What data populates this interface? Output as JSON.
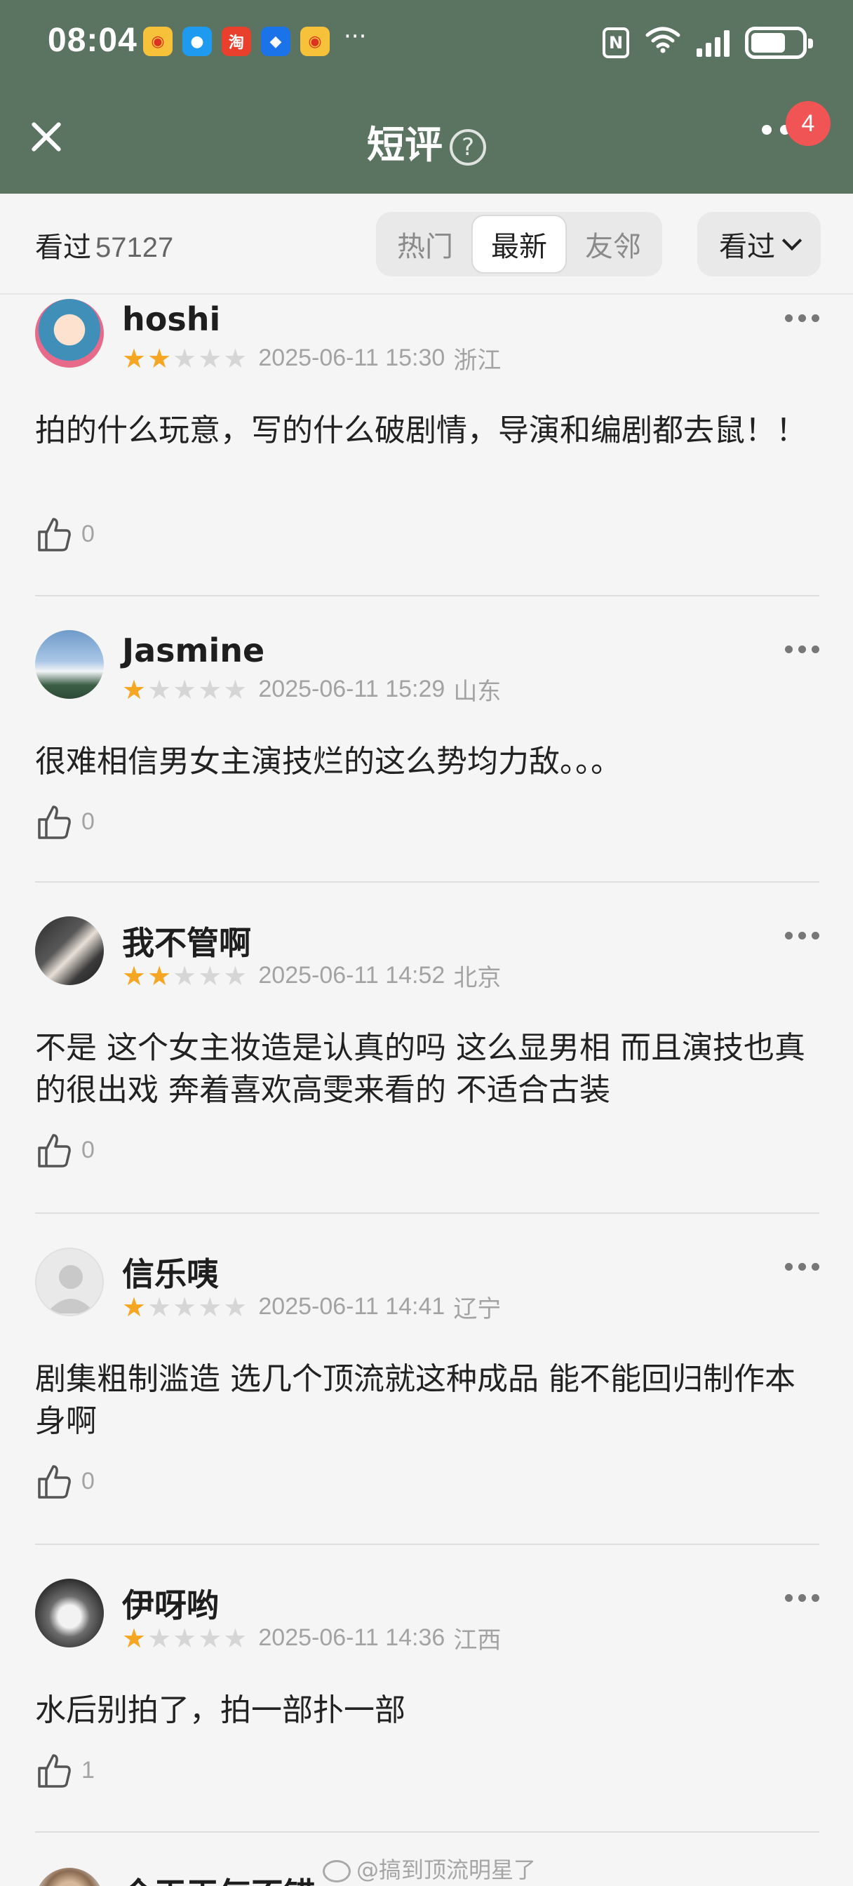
{
  "status_bar": {
    "time": "08:04",
    "app_icons": [
      "weibo-icon",
      "message-icon",
      "taobao-icon",
      "shield-icon",
      "weibo-icon"
    ],
    "more": "···",
    "network": "6"
  },
  "header": {
    "title": "短评",
    "help_icon": "?",
    "badge_count": "4"
  },
  "filter": {
    "seen_label": "看过",
    "seen_count": "57127",
    "tabs": [
      {
        "label": "热门",
        "active": false
      },
      {
        "label": "最新",
        "active": true
      },
      {
        "label": "友邻",
        "active": false
      }
    ],
    "dropdown_label": "看过"
  },
  "reviews": [
    {
      "name": "hoshi",
      "stars": 2,
      "date": "2025-06-11 15:30",
      "location": "浙江",
      "text": "拍的什么玩意，写的什么破剧情，导演和编剧都去鼠！！",
      "likes": "0"
    },
    {
      "name": "Jasmine",
      "stars": 1,
      "date": "2025-06-11 15:29",
      "location": "山东",
      "text": "很难相信男女主演技烂的这么势均力敌。。。",
      "likes": "0"
    },
    {
      "name": "我不管啊",
      "stars": 2,
      "date": "2025-06-11 14:52",
      "location": "北京",
      "text": "不是 这个女主妆造是认真的吗 这么显男相 而且演技也真的很出戏 奔着喜欢高雯来看的 不适合古装",
      "likes": "0"
    },
    {
      "name": "信乐咦",
      "stars": 1,
      "date": "2025-06-11 14:41",
      "location": "辽宁",
      "text": "剧集粗制滥造 选几个顶流就这种成品 能不能回归制作本身啊",
      "likes": "0"
    },
    {
      "name": "伊呀哟",
      "stars": 1,
      "date": "2025-06-11 14:36",
      "location": "江西",
      "text": "水后别拍了，拍一部扑一部",
      "likes": "1"
    },
    {
      "name": "今天天气不错",
      "stars": 0,
      "date": "",
      "location": "",
      "text": "",
      "likes": ""
    }
  ],
  "watermark": "@搞到顶流明星了",
  "colors": {
    "header_green": "#5b7461",
    "star_on": "#f5a623",
    "badge_red": "#f05454"
  }
}
